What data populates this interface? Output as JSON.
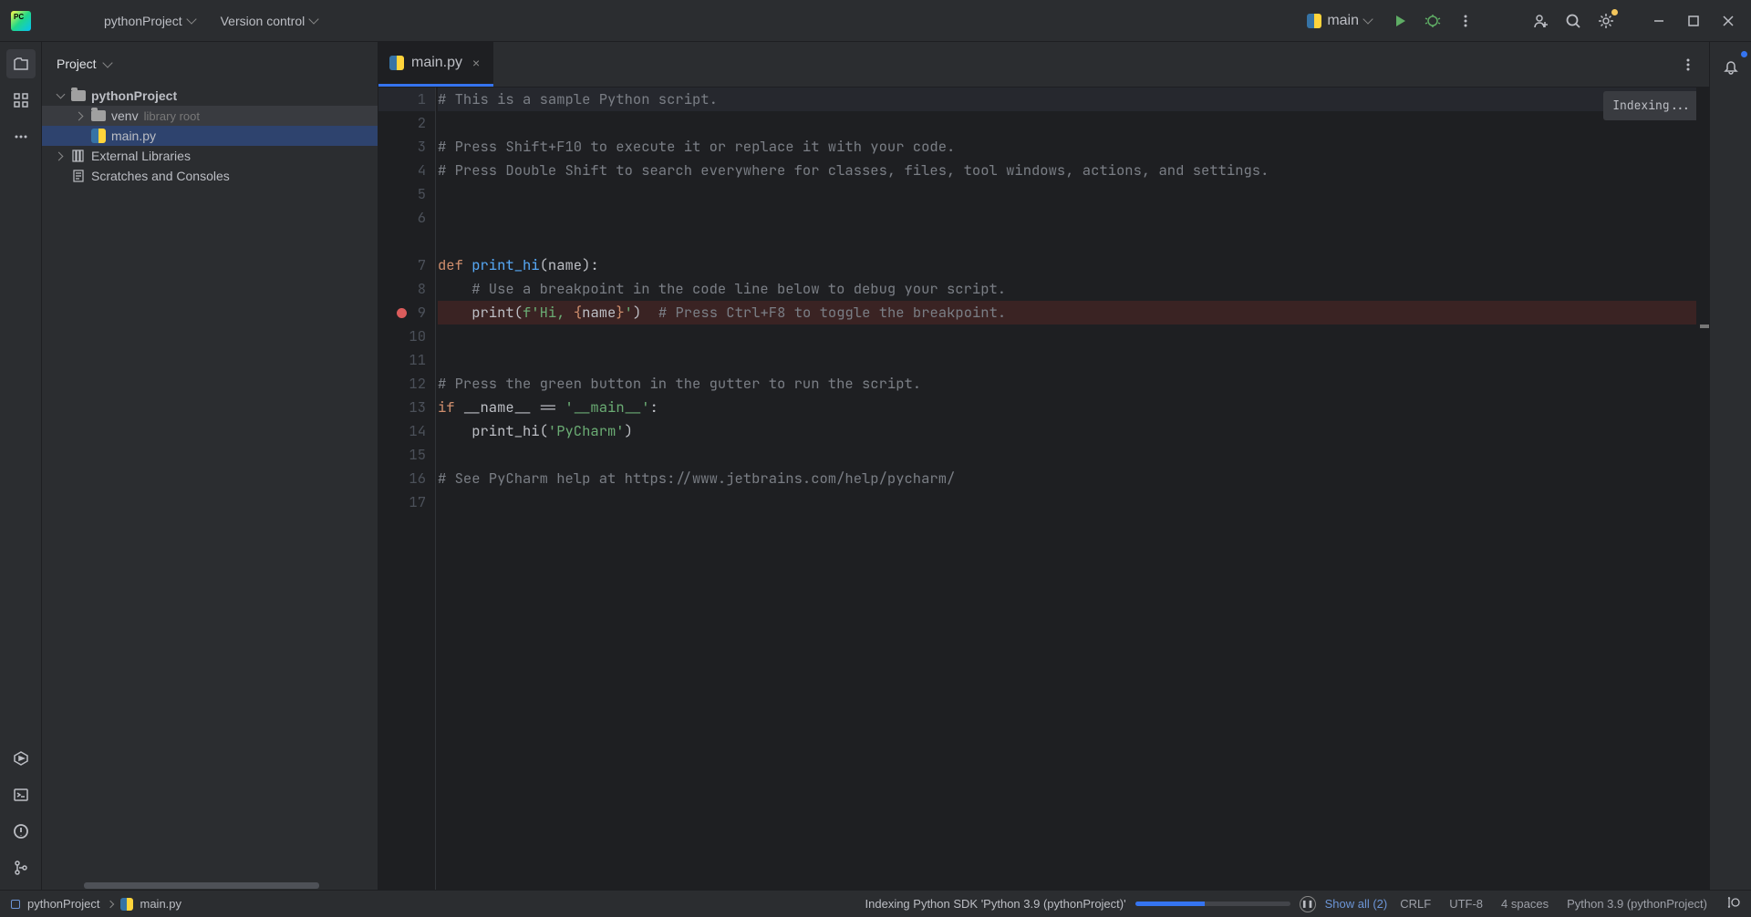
{
  "titlebar": {
    "project_name": "pythonProject",
    "vcs_label": "Version control"
  },
  "run": {
    "config_name": "main"
  },
  "project_panel": {
    "title": "Project",
    "root_name": "pythonProject",
    "venv_name": "venv",
    "venv_label": "library root",
    "main_file": "main.py",
    "external_libs": "External Libraries",
    "scratches": "Scratches and Consoles"
  },
  "tabs": {
    "active_file": "main.py"
  },
  "editor": {
    "indexing_label": "Indexing...",
    "lines": {
      "1": {
        "comment": "# This is a sample Python script."
      },
      "3": {
        "comment": "# Press Shift+F10 to execute it or replace it with your code."
      },
      "4": {
        "comment": "# Press Double Shift to search everywhere for classes, files, tool windows, actions, and settings."
      },
      "7": {
        "kw": "def ",
        "fn": "print_hi",
        "rest": "(name):"
      },
      "8": {
        "comment": "    # Use a breakpoint in the code line below to debug your script."
      },
      "9": {
        "indent": "    ",
        "call": "print(",
        "fpre": "f'Hi, ",
        "brace_open": "{",
        "var": "name",
        "brace_close": "}",
        "fpost": "'",
        "close": ")",
        "spacer": "  ",
        "comment": "# Press Ctrl+F8 to toggle the breakpoint."
      },
      "12": {
        "comment": "# Press the green button in the gutter to run the script."
      },
      "13": {
        "kw": "if ",
        "var": "__name__ == ",
        "str": "'__main__'",
        "rest": ":"
      },
      "14": {
        "indent": "    ",
        "call": "print_hi(",
        "str": "'PyCharm'",
        "close": ")"
      },
      "16": {
        "comment": "# See PyCharm help at https://www.jetbrains.com/help/pycharm/"
      }
    }
  },
  "statusbar": {
    "bc_project": "pythonProject",
    "bc_file": "main.py",
    "indexing_msg": "Indexing Python SDK 'Python 3.9 (pythonProject)'",
    "show_all": "Show all (2)",
    "line_sep": "CRLF",
    "encoding": "UTF-8",
    "indent": "4 spaces",
    "interpreter": "Python 3.9 (pythonProject)"
  }
}
